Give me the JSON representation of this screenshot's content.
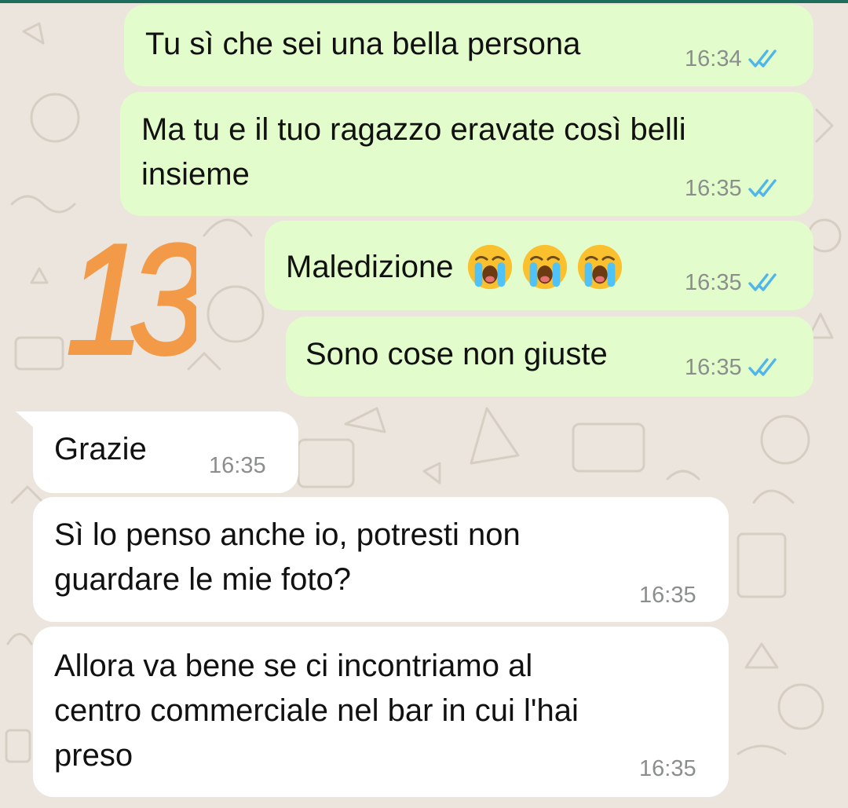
{
  "colors": {
    "outgoing_bubble": "#e2fccb",
    "incoming_bubble": "#ffffff",
    "read_ticks": "#4fb6ec",
    "sticker": "#f39a49",
    "timestamp": "#8a8f8c"
  },
  "sticker": {
    "text": "13"
  },
  "messages": [
    {
      "direction": "outgoing",
      "lines": [
        "Tu sì che sei una bella persona"
      ],
      "time": "16:34",
      "status": "read",
      "icon": "double-check-icon"
    },
    {
      "direction": "outgoing",
      "lines": [
        "Ma tu e il tuo ragazzo eravate così belli",
        "insieme"
      ],
      "time": "16:35",
      "status": "read",
      "icon": "double-check-icon"
    },
    {
      "direction": "outgoing",
      "lines": [
        "Maledizione"
      ],
      "emojis": [
        "loudly-crying-face-icon",
        "loudly-crying-face-icon",
        "loudly-crying-face-icon"
      ],
      "time": "16:35",
      "status": "read",
      "icon": "double-check-icon"
    },
    {
      "direction": "outgoing",
      "lines": [
        "Sono cose non giuste"
      ],
      "time": "16:35",
      "status": "read",
      "icon": "double-check-icon"
    },
    {
      "direction": "incoming",
      "lines": [
        "Grazie"
      ],
      "time": "16:35"
    },
    {
      "direction": "incoming",
      "lines": [
        "Sì lo penso anche io, potresti non",
        "guardare le mie foto?"
      ],
      "time": "16:35"
    },
    {
      "direction": "incoming",
      "lines": [
        "Allora va bene se ci incontriamo al",
        "centro commerciale nel bar in cui l'hai",
        "preso"
      ],
      "time": "16:35"
    }
  ]
}
